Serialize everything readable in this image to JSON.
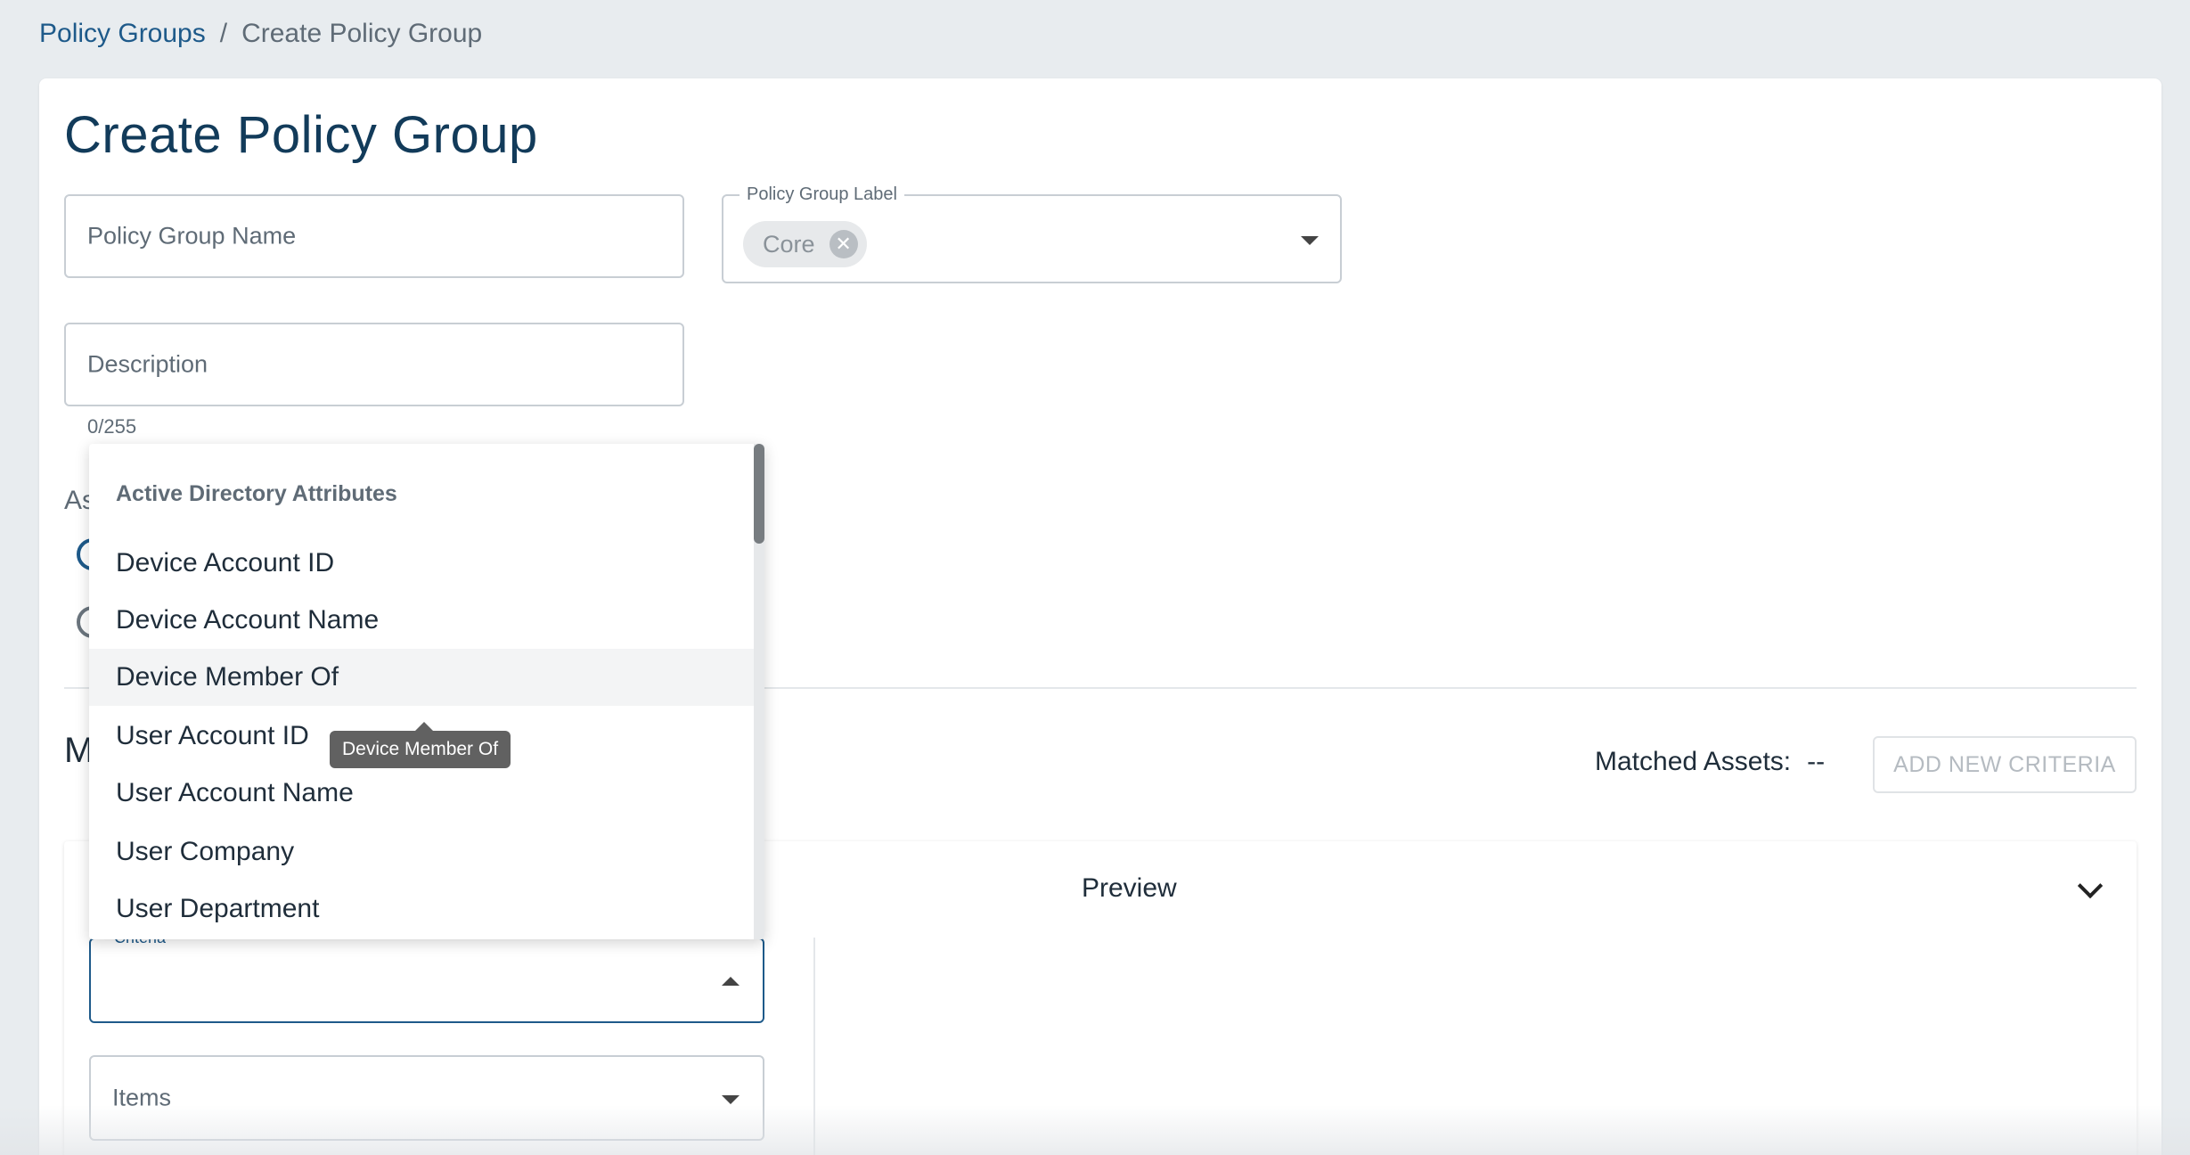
{
  "breadcrumb": {
    "parent": "Policy Groups",
    "separator": "/",
    "current": "Create Policy Group"
  },
  "page": {
    "title": "Create Policy Group"
  },
  "form": {
    "name_placeholder": "Policy Group Name",
    "label_field": {
      "label": "Policy Group Label",
      "chips": [
        "Core"
      ]
    },
    "description_placeholder": "Description",
    "description_counter": "0/255",
    "partial_section_text": "As"
  },
  "criteria_section": {
    "partial_heading": "M",
    "matched_assets_label": "Matched Assets:",
    "matched_assets_value": "--",
    "add_button": "ADD NEW CRITERIA",
    "preview_label": "Preview",
    "criteria_field_label": "Criteria",
    "items_placeholder": "Items"
  },
  "dropdown": {
    "group_header": "Active Directory Attributes",
    "items": [
      "Device Account ID",
      "Device Account Name",
      "Device Member Of",
      "User Account ID",
      "User Account Name",
      "User Company",
      "User Department"
    ],
    "hovered_index": 2
  },
  "tooltip": {
    "text": "Device Member Of"
  }
}
